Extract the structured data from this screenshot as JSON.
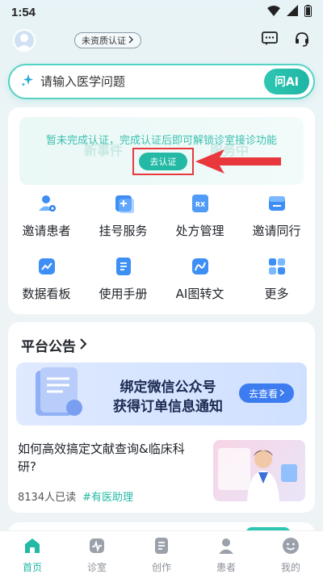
{
  "status_bar": {
    "time": "1:54"
  },
  "header": {
    "cert_status": "未资质认证"
  },
  "search": {
    "placeholder": "请输入医学问题",
    "ask_button": "问AI"
  },
  "notice": {
    "message": "暂未完成认证，完成认证后即可解锁诊室接诊功能",
    "button": "去认证",
    "ghost_left": "新事件",
    "ghost_right": "服务中"
  },
  "quick_actions": [
    {
      "label": "邀请患者",
      "icon": "invite-patient-icon"
    },
    {
      "label": "挂号服务",
      "icon": "registration-icon"
    },
    {
      "label": "处方管理",
      "icon": "prescription-icon"
    },
    {
      "label": "邀请同行",
      "icon": "invite-peer-icon"
    },
    {
      "label": "数据看板",
      "icon": "dashboard-icon"
    },
    {
      "label": "使用手册",
      "icon": "manual-icon"
    },
    {
      "label": "AI图转文",
      "icon": "ai-image-to-text-icon"
    },
    {
      "label": "更多",
      "icon": "more-grid-icon"
    }
  ],
  "announcement": {
    "title": "平台公告",
    "banner": {
      "line1": "绑定微信公众号",
      "line2": "获得订单信息通知",
      "button": "去查看"
    },
    "carousel": {
      "count": 3,
      "active": 1
    }
  },
  "article": {
    "title": "如何高效搞定文献查询&临床科研?",
    "reads": "8134人已读",
    "tag": "#有医助理"
  },
  "tabs": [
    {
      "label": "首页",
      "icon": "home-icon",
      "active": true
    },
    {
      "label": "诊室",
      "icon": "clinic-icon",
      "active": false
    },
    {
      "label": "创作",
      "icon": "create-icon",
      "active": false
    },
    {
      "label": "患者",
      "icon": "patient-icon",
      "active": false
    },
    {
      "label": "我的",
      "icon": "profile-icon",
      "active": false
    }
  ],
  "colors": {
    "accent": "#23b9a4",
    "highlight": "#e8383d",
    "banner_button": "#3c7cf0"
  }
}
